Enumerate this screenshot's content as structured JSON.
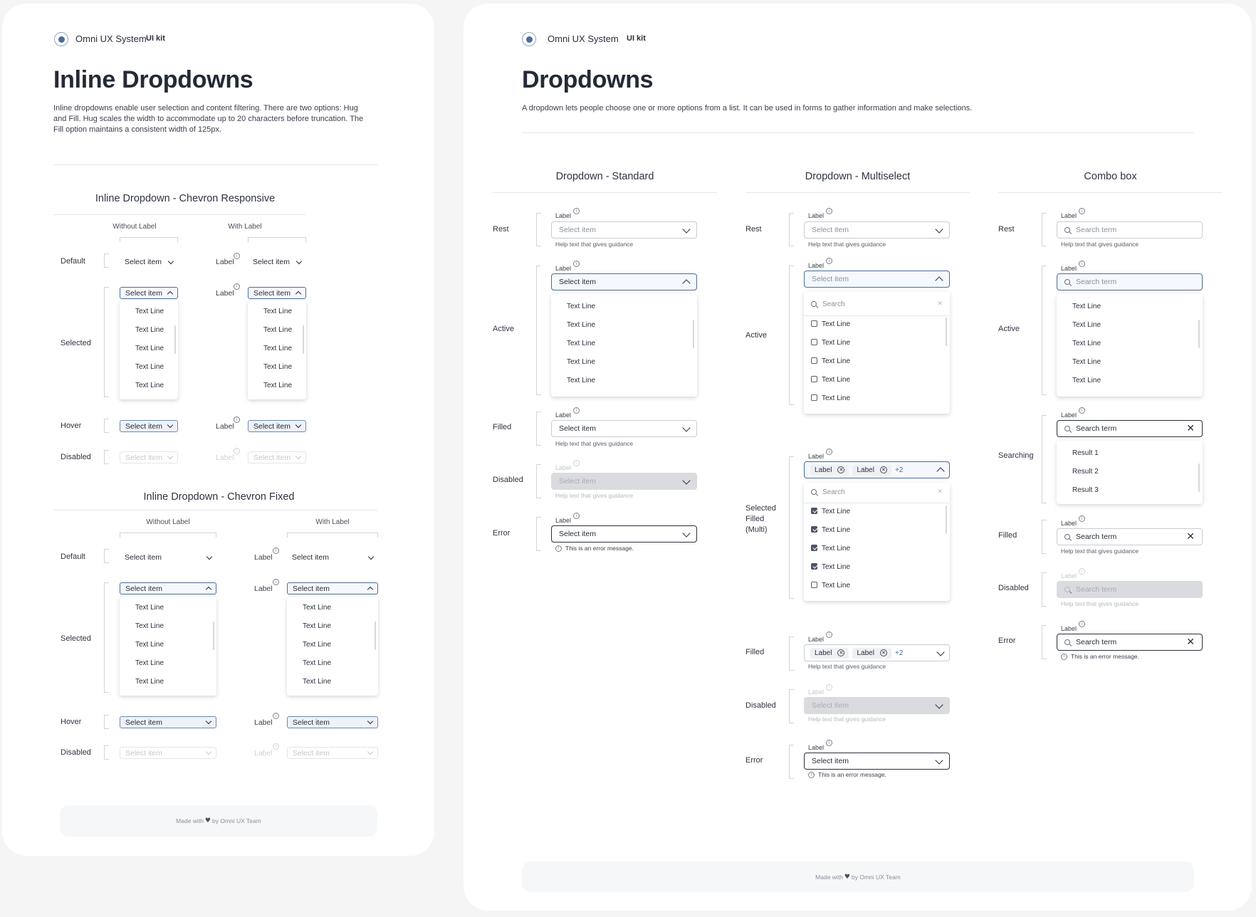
{
  "brand": {
    "name": "Omni UX System",
    "kit": "UI kit"
  },
  "left": {
    "title": "Inline Dropdowns",
    "description": "Inline dropdowns enable user selection and content filtering. There are two options: Hug and Fill. Hug scales the width to accommodate up to 20 characters before truncation. The Fill option maintains a consistent width of 125px.",
    "section1": "Inline Dropdown - Chevron Responsive",
    "section2": "Inline Dropdown - Chevron Fixed",
    "col_without": "Without Label",
    "col_with": "With Label",
    "rows": {
      "default": "Default",
      "selected": "Selected",
      "hover": "Hover",
      "disabled": "Disabled"
    },
    "label": "Label",
    "select_item": "Select item",
    "text_line": "Text Line"
  },
  "right": {
    "title": "Dropdowns",
    "description": "A dropdown lets people choose one or more options from a list. It can be used in forms to gather information and make selections.",
    "col_standard": "Dropdown - Standard",
    "col_multi": "Dropdown - Multiselect",
    "col_combo": "Combo box",
    "rows": {
      "rest": "Rest",
      "active": "Active",
      "filled": "Filled",
      "disabled": "Disabled",
      "error": "Error",
      "searching": "Searching",
      "selected_filled_1": "Selected",
      "selected_filled_2": "Filled",
      "selected_filled_3": "(Multi)"
    },
    "label": "Label",
    "select_item": "Select item",
    "search_term": "Search term",
    "search": "Search",
    "help": "Help text that gives guidance",
    "error": "This is an error message.",
    "text_line": "Text Line",
    "tag": "Label",
    "more": "+2",
    "results": [
      "Result 1",
      "Result 2",
      "Result 3"
    ]
  },
  "footer": {
    "before": "Made with",
    "after": "by Omni UX Team"
  },
  "colors": {
    "accent": "#4b6c9a",
    "text": "#262b36",
    "disabled": "#d9dbde"
  }
}
